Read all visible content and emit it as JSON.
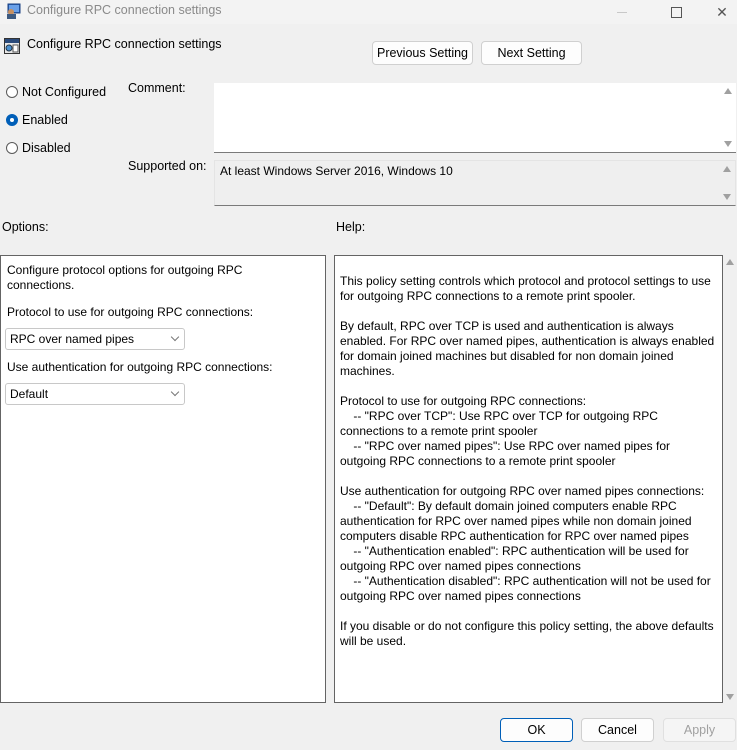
{
  "window": {
    "title": "Configure RPC connection settings",
    "controls": {
      "minimize": "—",
      "maximize": "☐",
      "close": "✕"
    }
  },
  "header": {
    "policy_title": "Configure RPC connection settings",
    "previous_button": "Previous Setting",
    "next_button": "Next Setting"
  },
  "state": {
    "options": [
      {
        "label": "Not Configured",
        "checked": false
      },
      {
        "label": "Enabled",
        "checked": true
      },
      {
        "label": "Disabled",
        "checked": false
      }
    ]
  },
  "comment": {
    "label": "Comment:",
    "value": ""
  },
  "supported": {
    "label": "Supported on:",
    "value": "At least Windows Server 2016, Windows 10"
  },
  "options_section": {
    "heading": "Options:",
    "description": "Configure protocol options for outgoing RPC connections.",
    "protocol_label": "Protocol to use for outgoing RPC connections:",
    "protocol_value": "RPC over named pipes",
    "auth_label": "Use authentication for outgoing RPC connections:",
    "auth_value": "Default"
  },
  "help_section": {
    "heading": "Help:",
    "text": "This policy setting controls which protocol and protocol settings to use for outgoing RPC connections to a remote print spooler.\n\nBy default, RPC over TCP is used and authentication is always enabled. For RPC over named pipes, authentication is always enabled for domain joined machines but disabled for non domain joined machines.\n\nProtocol to use for outgoing RPC connections:\n    -- \"RPC over TCP\": Use RPC over TCP for outgoing RPC connections to a remote print spooler\n    -- \"RPC over named pipes\": Use RPC over named pipes for outgoing RPC connections to a remote print spooler\n\nUse authentication for outgoing RPC over named pipes connections:\n    -- \"Default\": By default domain joined computers enable RPC authentication for RPC over named pipes while non domain joined computers disable RPC authentication for RPC over named pipes\n    -- \"Authentication enabled\": RPC authentication will be used for outgoing RPC over named pipes connections\n    -- \"Authentication disabled\": RPC authentication will not be used for outgoing RPC over named pipes connections\n\nIf you disable or do not configure this policy setting, the above defaults will be used."
  },
  "footer": {
    "ok": "OK",
    "cancel": "Cancel",
    "apply": "Apply"
  },
  "colors": {
    "accent": "#005fb8",
    "background": "#f0f0f0"
  }
}
